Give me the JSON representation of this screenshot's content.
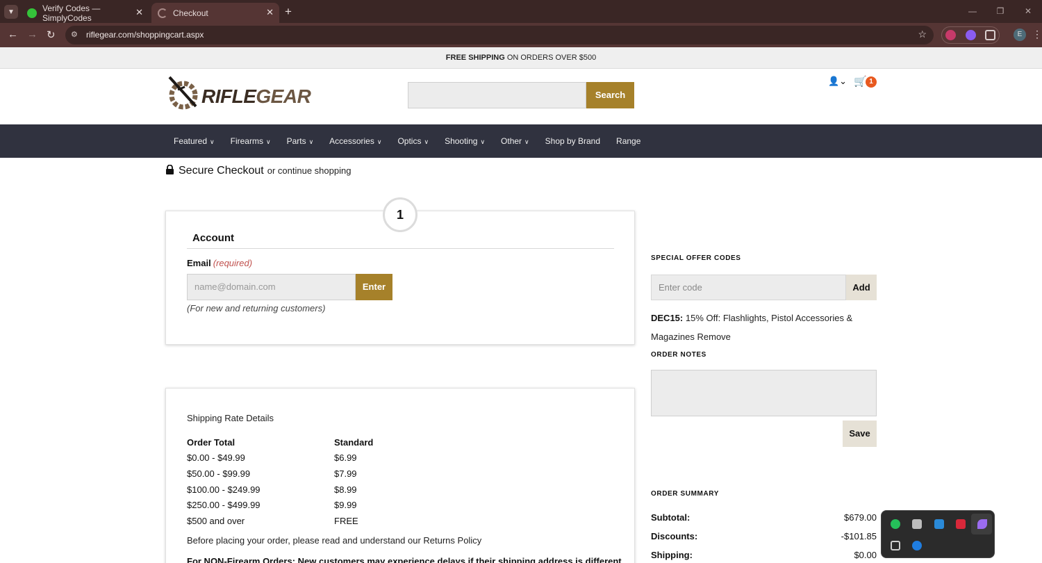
{
  "browser": {
    "tabs": [
      {
        "title": "Verify Codes — SimplyCodes",
        "active": false
      },
      {
        "title": "Checkout",
        "active": true
      }
    ],
    "url": "riflegear.com/shoppingcart.aspx",
    "profile_initial": "E"
  },
  "promo": {
    "bold": "FREE SHIPPING",
    "rest": " ON ORDERS OVER $500"
  },
  "header": {
    "logo_rifle": "RIFLE",
    "logo_gear": "GEAR",
    "search_button": "Search",
    "cart_count": "1"
  },
  "nav": {
    "items": [
      {
        "label": "Featured",
        "has_dropdown": true
      },
      {
        "label": "Firearms",
        "has_dropdown": true
      },
      {
        "label": "Parts",
        "has_dropdown": true
      },
      {
        "label": "Accessories",
        "has_dropdown": true
      },
      {
        "label": "Optics",
        "has_dropdown": true
      },
      {
        "label": "Shooting",
        "has_dropdown": true
      },
      {
        "label": "Other",
        "has_dropdown": true
      },
      {
        "label": "Shop by Brand",
        "has_dropdown": false
      },
      {
        "label": "Range",
        "has_dropdown": false
      }
    ]
  },
  "checkout": {
    "title": "Secure Checkout",
    "continue": "or continue shopping",
    "step_number": "1",
    "account_title": "Account",
    "email_label": "Email",
    "email_required": "(required)",
    "email_placeholder": "name@domain.com",
    "enter_button": "Enter",
    "email_help": "(For new and returning customers)"
  },
  "shipping": {
    "title": "Shipping Rate Details",
    "headers": [
      "Order Total",
      "Standard"
    ],
    "rows": [
      [
        "$0.00 - $49.99",
        "$6.99"
      ],
      [
        "$50.00 - $99.99",
        "$7.99"
      ],
      [
        "$100.00 - $249.99",
        "$8.99"
      ],
      [
        "$250.00 - $499.99",
        "$9.99"
      ],
      [
        "$500 and over",
        "FREE"
      ]
    ],
    "returns_text": "Before placing your order, please read and understand our Returns Policy",
    "warning_text": "For NON-Firearm Orders: New customers may experience delays if their shipping address is different"
  },
  "sidebar": {
    "offer_heading": "SPECIAL OFFER CODES",
    "code_placeholder": "Enter code",
    "add_button": "Add",
    "applied_code": "DEC15:",
    "applied_desc": " 15% Off: Flashlights, Pistol Accessories & Magazines",
    "remove_link": "Remove",
    "notes_heading": "ORDER NOTES",
    "save_button": "Save",
    "summary_heading": "ORDER SUMMARY",
    "summary": [
      {
        "label": "Subtotal:",
        "value": "$679.00"
      },
      {
        "label": "Discounts:",
        "value": "-$101.85"
      },
      {
        "label": "Shipping:",
        "value": "$0.00"
      }
    ]
  },
  "colors": {
    "accent": "#a6812a",
    "nav_bg": "#30323f",
    "cart_badge": "#e8591f",
    "browser_frame": "#3a2625"
  }
}
